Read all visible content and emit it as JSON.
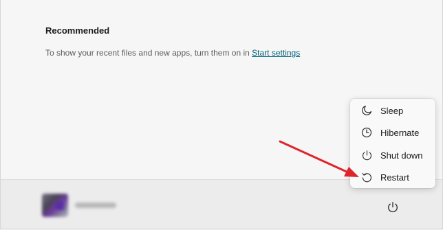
{
  "recommended": {
    "title": "Recommended",
    "message": "To show your recent files and new apps, turn them on in ",
    "link": "Start settings"
  },
  "power_menu": {
    "items": [
      {
        "label": "Sleep",
        "icon": "moon-icon"
      },
      {
        "label": "Hibernate",
        "icon": "clock-icon"
      },
      {
        "label": "Shut down",
        "icon": "power-icon"
      },
      {
        "label": "Restart",
        "icon": "restart-icon"
      }
    ]
  },
  "footer": {
    "power_icon": "power-icon"
  },
  "colors": {
    "link": "#00607a",
    "annotation_arrow": "#e0242b"
  }
}
